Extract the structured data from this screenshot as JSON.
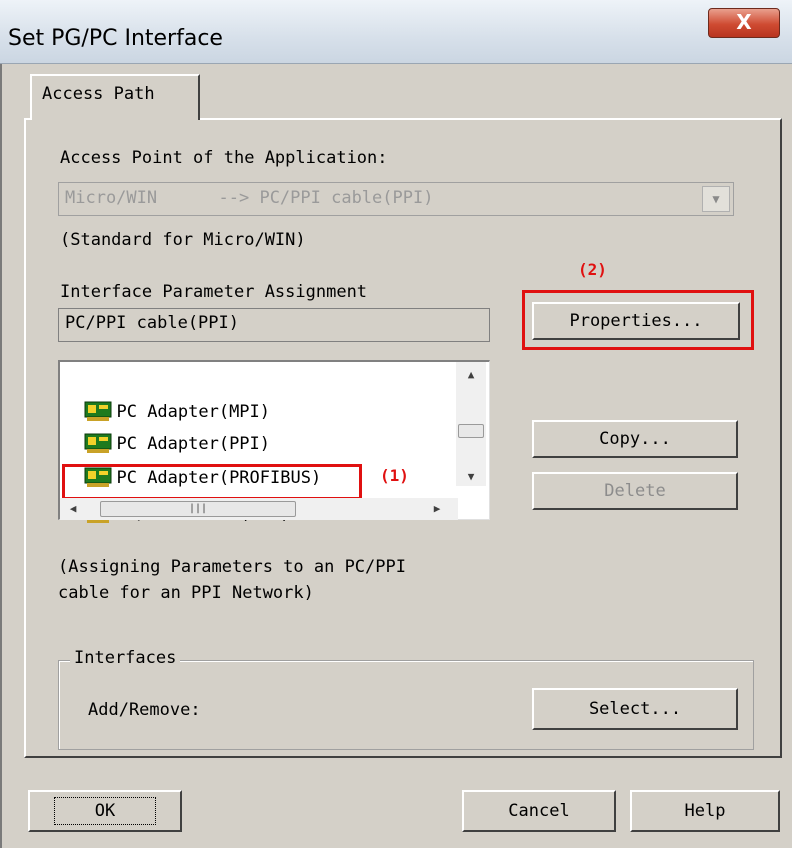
{
  "window": {
    "title": "Set PG/PC Interface",
    "close_glyph": "X"
  },
  "tab": {
    "label": "Access Path"
  },
  "access_point": {
    "label": "Access Point of the Application:",
    "value": "Micro/WIN      --> PC/PPI cable(PPI)",
    "note": "(Standard for Micro/WIN)"
  },
  "interface_param": {
    "label": "Interface Parameter Assignment",
    "value": "PC/PPI cable(PPI)"
  },
  "list": {
    "items": [
      {
        "label": "PC Adapter(MPI)",
        "icon": "network-card-icon"
      },
      {
        "label": "PC Adapter(PPI)",
        "icon": "network-card-icon"
      },
      {
        "label": "PC Adapter(PROFIBUS)",
        "icon": "network-card-icon"
      },
      {
        "label": "PC/PPI cable(PPI)",
        "icon": "network-card-icon"
      }
    ],
    "selected_index": 3
  },
  "buttons": {
    "properties": "Properties...",
    "copy": "Copy...",
    "delete": "Delete",
    "select": "Select...",
    "ok": "OK",
    "cancel": "Cancel",
    "help": "Help"
  },
  "description": "(Assigning Parameters to an PC/PPI\ncable for an PPI Network)",
  "interfaces": {
    "title": "Interfaces",
    "add_remove_label": "Add/Remove:"
  },
  "annotations": {
    "one": "(1)",
    "two": "(2)"
  },
  "colors": {
    "annotation": "#e01010",
    "dialog_bg": "#d4d0c8"
  }
}
